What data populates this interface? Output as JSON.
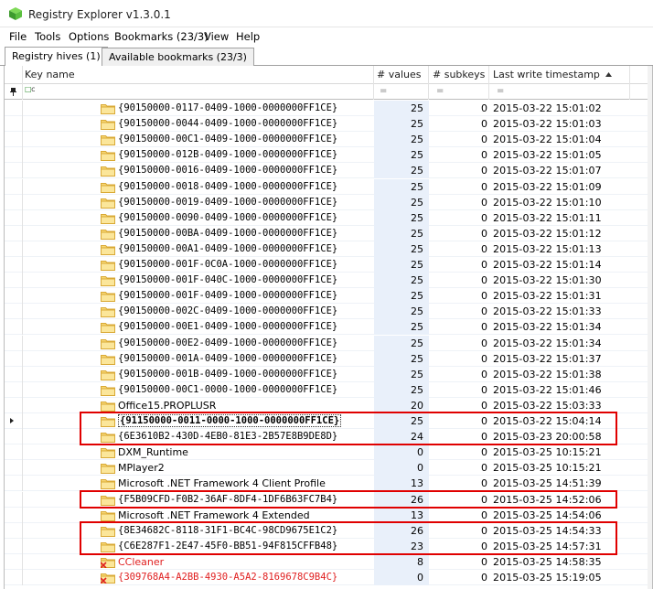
{
  "window": {
    "title": "Registry Explorer v1.3.0.1",
    "app_icon": "registry-explorer-icon"
  },
  "menu": [
    "File",
    "Tools",
    "Options",
    "Bookmarks (23/3)",
    "View",
    "Help"
  ],
  "tabs": [
    {
      "label": "Registry hives (1)",
      "active": true
    },
    {
      "label": "Available bookmarks (23/3)",
      "active": false
    }
  ],
  "columns": {
    "key_name": "Key name",
    "values": "# values",
    "subkeys": "# subkeys",
    "timestamp": "Last write timestamp"
  },
  "filter": {
    "pin_icon": "pin-icon",
    "abc_icon": "abc-filter-icon",
    "eq": "="
  },
  "rows": [
    {
      "name": "{90150000-0117-0409-1000-0000000FF1CE}",
      "values": "25",
      "subkeys": "0",
      "timestamp": "2015-03-22 15:01:02"
    },
    {
      "name": "{90150000-0044-0409-1000-0000000FF1CE}",
      "values": "25",
      "subkeys": "0",
      "timestamp": "2015-03-22 15:01:03"
    },
    {
      "name": "{90150000-00C1-0409-1000-0000000FF1CE}",
      "values": "25",
      "subkeys": "0",
      "timestamp": "2015-03-22 15:01:04"
    },
    {
      "name": "{90150000-012B-0409-1000-0000000FF1CE}",
      "values": "25",
      "subkeys": "0",
      "timestamp": "2015-03-22 15:01:05"
    },
    {
      "name": "{90150000-0016-0409-1000-0000000FF1CE}",
      "values": "25",
      "subkeys": "0",
      "timestamp": "2015-03-22 15:01:07"
    },
    {
      "name": "{90150000-0018-0409-1000-0000000FF1CE}",
      "values": "25",
      "subkeys": "0",
      "timestamp": "2015-03-22 15:01:09"
    },
    {
      "name": "{90150000-0019-0409-1000-0000000FF1CE}",
      "values": "25",
      "subkeys": "0",
      "timestamp": "2015-03-22 15:01:10"
    },
    {
      "name": "{90150000-0090-0409-1000-0000000FF1CE}",
      "values": "25",
      "subkeys": "0",
      "timestamp": "2015-03-22 15:01:11"
    },
    {
      "name": "{90150000-00BA-0409-1000-0000000FF1CE}",
      "values": "25",
      "subkeys": "0",
      "timestamp": "2015-03-22 15:01:12"
    },
    {
      "name": "{90150000-00A1-0409-1000-0000000FF1CE}",
      "values": "25",
      "subkeys": "0",
      "timestamp": "2015-03-22 15:01:13"
    },
    {
      "name": "{90150000-001F-0C0A-1000-0000000FF1CE}",
      "values": "25",
      "subkeys": "0",
      "timestamp": "2015-03-22 15:01:14"
    },
    {
      "name": "{90150000-001F-040C-1000-0000000FF1CE}",
      "values": "25",
      "subkeys": "0",
      "timestamp": "2015-03-22 15:01:30"
    },
    {
      "name": "{90150000-001F-0409-1000-0000000FF1CE}",
      "values": "25",
      "subkeys": "0",
      "timestamp": "2015-03-22 15:01:31"
    },
    {
      "name": "{90150000-002C-0409-1000-0000000FF1CE}",
      "values": "25",
      "subkeys": "0",
      "timestamp": "2015-03-22 15:01:33"
    },
    {
      "name": "{90150000-00E1-0409-1000-0000000FF1CE}",
      "values": "25",
      "subkeys": "0",
      "timestamp": "2015-03-22 15:01:34"
    },
    {
      "name": "{90150000-00E2-0409-1000-0000000FF1CE}",
      "values": "25",
      "subkeys": "0",
      "timestamp": "2015-03-22 15:01:34"
    },
    {
      "name": "{90150000-001A-0409-1000-0000000FF1CE}",
      "values": "25",
      "subkeys": "0",
      "timestamp": "2015-03-22 15:01:37"
    },
    {
      "name": "{90150000-001B-0409-1000-0000000FF1CE}",
      "values": "25",
      "subkeys": "0",
      "timestamp": "2015-03-22 15:01:38"
    },
    {
      "name": "{90150000-00C1-0000-1000-0000000FF1CE}",
      "values": "25",
      "subkeys": "0",
      "timestamp": "2015-03-22 15:01:46"
    },
    {
      "name": "Office15.PROPLUSR",
      "values": "20",
      "subkeys": "0",
      "timestamp": "2015-03-22 15:03:33",
      "plain": true
    },
    {
      "name": "{91150000-0011-0000-1000-0000000FF1CE}",
      "values": "25",
      "subkeys": "0",
      "timestamp": "2015-03-22 15:04:14",
      "selected": true
    },
    {
      "name": "{6E3610B2-430D-4EB0-81E3-2B57E8B9DE8D}",
      "values": "24",
      "subkeys": "0",
      "timestamp": "2015-03-23 20:00:58"
    },
    {
      "name": "DXM_Runtime",
      "values": "0",
      "subkeys": "0",
      "timestamp": "2015-03-25 10:15:21",
      "plain": true
    },
    {
      "name": "MPlayer2",
      "values": "0",
      "subkeys": "0",
      "timestamp": "2015-03-25 10:15:21",
      "plain": true
    },
    {
      "name": "Microsoft .NET Framework 4 Client Profile",
      "values": "13",
      "subkeys": "0",
      "timestamp": "2015-03-25 14:51:39",
      "plain": true
    },
    {
      "name": "{F5B09CFD-F0B2-36AF-8DF4-1DF6B63FC7B4}",
      "values": "26",
      "subkeys": "0",
      "timestamp": "2015-03-25 14:52:06"
    },
    {
      "name": "Microsoft .NET Framework 4 Extended",
      "values": "13",
      "subkeys": "0",
      "timestamp": "2015-03-25 14:54:06",
      "plain": true
    },
    {
      "name": "{8E34682C-8118-31F1-BC4C-98CD9675E1C2}",
      "values": "26",
      "subkeys": "0",
      "timestamp": "2015-03-25 14:54:33"
    },
    {
      "name": "{C6E287F1-2E47-45F0-BB51-94F815CFFB48}",
      "values": "23",
      "subkeys": "0",
      "timestamp": "2015-03-25 14:57:31"
    },
    {
      "name": "CCleaner",
      "values": "8",
      "subkeys": "0",
      "timestamp": "2015-03-25 14:58:35",
      "plain": true,
      "deleted": true
    },
    {
      "name": "{309768A4-A2BB-4930-A5A2-8169678C9B4C}",
      "values": "0",
      "subkeys": "0",
      "timestamp": "2015-03-25 15:19:05",
      "deleted": true
    }
  ],
  "highlight_groups": [
    [
      20,
      21
    ],
    [
      25,
      25
    ],
    [
      27,
      28
    ]
  ],
  "colors": {
    "folder_fill": "#f7d774",
    "folder_edge": "#d9a935",
    "deleted_text": "#e02020",
    "highlight_border": "#e00000",
    "value_column_tint": "#e9f0fa"
  }
}
